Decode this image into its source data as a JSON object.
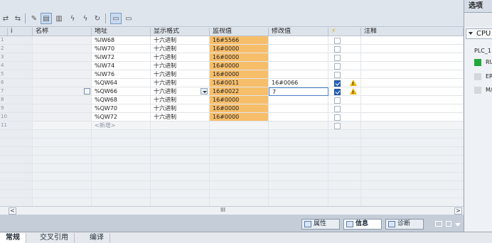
{
  "toolbar": {
    "icons": [
      "monitor-all-icon",
      "monitor-once-icon",
      "rename-icon",
      "display-format-icon",
      "show-hide-icon",
      "modify-now-icon",
      "modify-trigger-icon",
      "force-icon",
      "monitor-values-icon",
      "modify-values-icon"
    ]
  },
  "table": {
    "headers": {
      "index": "i",
      "name": "名称",
      "address": "地址",
      "format": "显示格式",
      "monitor": "监视值",
      "modify": "修改值",
      "flag": "⚡",
      "comment": "注释"
    },
    "rows": [
      {
        "n": "1",
        "address": "%IW68",
        "format": "十六进制",
        "monitor": "16#5566",
        "modify": "",
        "checked": false,
        "warn": false
      },
      {
        "n": "2",
        "address": "%IW70",
        "format": "十六进制",
        "monitor": "16#0000",
        "modify": "",
        "checked": false,
        "warn": false
      },
      {
        "n": "3",
        "address": "%IW72",
        "format": "十六进制",
        "monitor": "16#0000",
        "modify": "",
        "checked": false,
        "warn": false
      },
      {
        "n": "4",
        "address": "%IW74",
        "format": "十六进制",
        "monitor": "16#0000",
        "modify": "",
        "checked": false,
        "warn": false
      },
      {
        "n": "5",
        "address": "%IW76",
        "format": "十六进制",
        "monitor": "16#0000",
        "modify": "",
        "checked": false,
        "warn": false
      },
      {
        "n": "6",
        "address": "%QW64",
        "format": "十六进制",
        "monitor": "16#0011",
        "modify": "16#0066",
        "checked": true,
        "warn": true
      },
      {
        "n": "7",
        "address": "%QW66",
        "format": "十六进制",
        "monitor": "16#0022",
        "modify": "7",
        "checked": true,
        "warn": true
      },
      {
        "n": "8",
        "address": "%QW68",
        "format": "十六进制",
        "monitor": "16#0000",
        "modify": "",
        "checked": false,
        "warn": false
      },
      {
        "n": "9",
        "address": "%QW70",
        "format": "十六进制",
        "monitor": "16#0000",
        "modify": "",
        "checked": false,
        "warn": false
      },
      {
        "n": "10",
        "address": "%QW72",
        "format": "十六进制",
        "monitor": "16#0000",
        "modify": "",
        "checked": false,
        "warn": false
      },
      {
        "n": "11",
        "address": "<新增>",
        "format": "",
        "monitor": "",
        "modify": "",
        "checked": false,
        "warn": false
      }
    ]
  },
  "scroll": {
    "left": "<",
    "right": ">",
    "grip": "III"
  },
  "inspector": {
    "tabs": [
      "属性",
      "信息",
      "诊断"
    ],
    "active": "信息"
  },
  "subtabs": [
    "常规",
    "交叉引用",
    "编译"
  ],
  "right_panel": {
    "title": "选项",
    "cpu": "CPU",
    "plc": "PLC_1",
    "leds": [
      {
        "label": "RU",
        "color": "#1fa83a"
      },
      {
        "label": "ER",
        "color": "#d4d8de"
      },
      {
        "label": "M/",
        "color": "#d4d8de"
      }
    ]
  }
}
